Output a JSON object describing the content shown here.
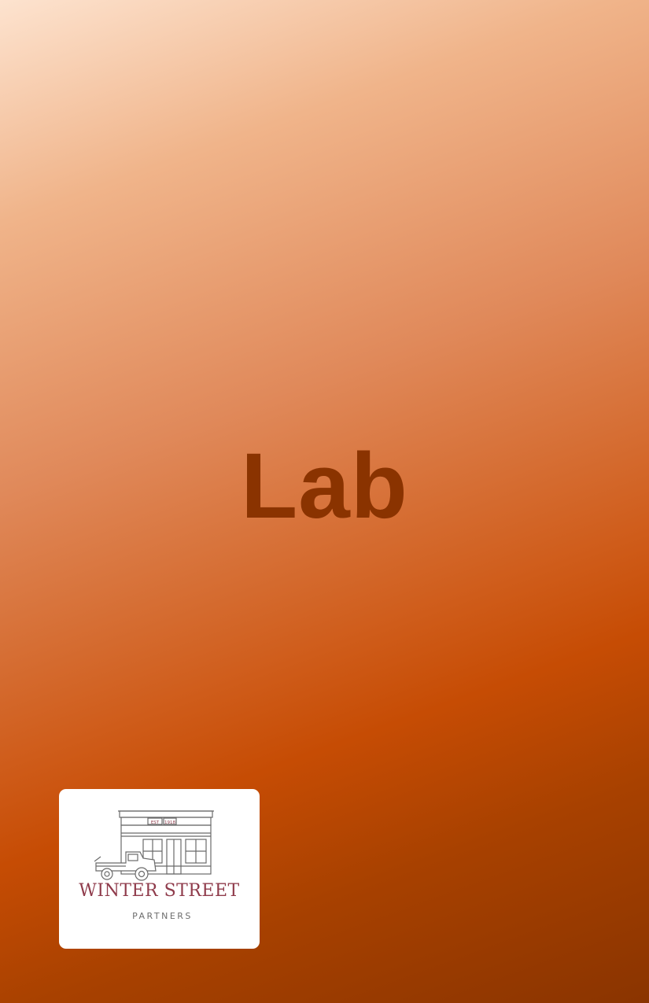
{
  "title": "Lab",
  "logo": {
    "name": "WINTER STREET",
    "subtitle": "PARTNERS",
    "sign_est": "EST",
    "sign_year": "1918",
    "icon": "storefront-with-vintage-truck-icon"
  },
  "colors": {
    "title": "#8a3300",
    "logo_name": "#8f3b4b",
    "logo_sub": "#6d6d6d",
    "gradient_light": "#fde3cf",
    "gradient_mid": "#c64c04",
    "gradient_dark": "#8a3400"
  }
}
